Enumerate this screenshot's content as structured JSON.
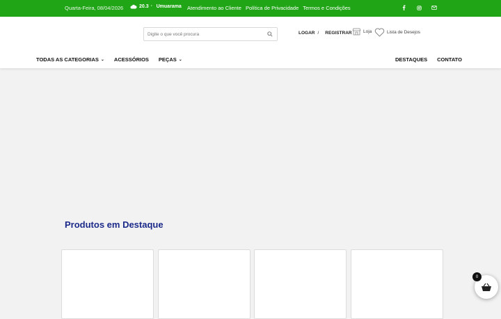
{
  "topbar": {
    "date": "Quarta-Feira, 08/04/2026",
    "weather_temp": "20.3",
    "weather_unit": "°",
    "weather_city": "Umuarama",
    "links": [
      "Atendimento ao Cliente",
      "Política de Privacidade",
      "Termos e Condições"
    ],
    "social_icons": [
      "facebook-icon",
      "instagram-icon",
      "email-icon"
    ],
    "bg_color": "#1fa516"
  },
  "header": {
    "search_placeholder": "Digite o que você procura",
    "login_label": "LOGAR",
    "separator": "/",
    "register_label": "REGISTRAR",
    "store_label": "Loja",
    "wishlist_label": "Lista de Desejos"
  },
  "nav": {
    "left": [
      {
        "label": "TODAS AS CATEGORIAS",
        "has_dropdown": true
      },
      {
        "label": "ACESSÓRIOS",
        "has_dropdown": false
      },
      {
        "label": "PEÇAS",
        "has_dropdown": true
      }
    ],
    "right": [
      "DESTAQUES",
      "CONTATO"
    ]
  },
  "main": {
    "featured_title": "Produtos em Destaque",
    "title_color": "#1b2a8a"
  },
  "cart": {
    "count": "0"
  }
}
